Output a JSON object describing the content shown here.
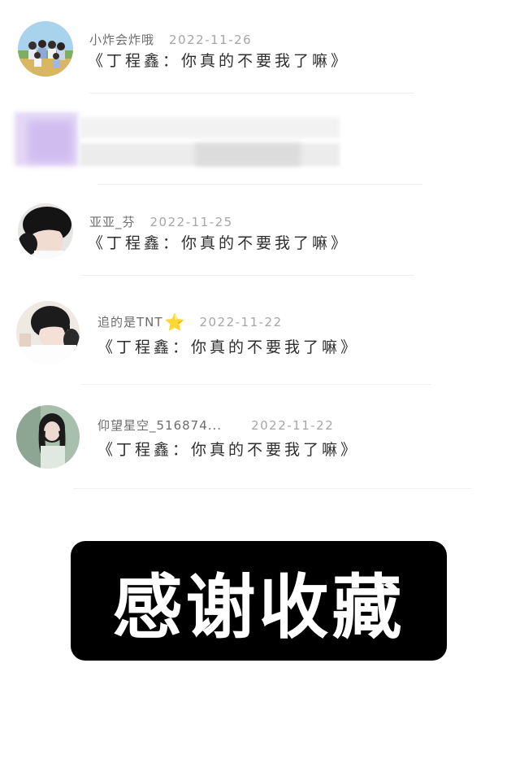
{
  "comments": [
    {
      "username": "小炸会炸哦",
      "date": "2022-11-26",
      "message": "《丁程鑫：你真的不要我了嘛》",
      "avatar_icon": "group-photo-avatar"
    },
    {
      "username": "亚亚_芬",
      "date": "2022-11-25",
      "message": "《丁程鑫：你真的不要我了嘛》",
      "avatar_icon": "dark-hair-boy-avatar"
    },
    {
      "username": "追的是TNT",
      "badge": "⭐",
      "date": "2022-11-22",
      "message": "《丁程鑫：你真的不要我了嘛》",
      "avatar_icon": "boy-leaning-avatar"
    },
    {
      "username": "仰望星空_516874...",
      "date": "2022-11-22",
      "message": "《丁程鑫：你真的不要我了嘛》",
      "avatar_icon": "long-hair-girl-avatar"
    }
  ],
  "banner": {
    "text": "感谢收藏"
  },
  "colors": {
    "banner_bg": "#000000",
    "banner_text": "#ffffff",
    "date_text": "#a6a6a6",
    "blur_accent": "#d9c9f2"
  }
}
